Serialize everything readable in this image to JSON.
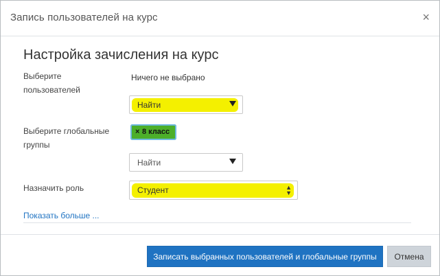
{
  "dialog": {
    "title": "Запись пользователей на курс",
    "close_glyph": "×",
    "section_title": "Настройка зачисления на курс"
  },
  "form": {
    "users": {
      "label": "Выберите пользователей",
      "value": "Ничего не выбрано",
      "search": "Найти"
    },
    "groups": {
      "label": "Выберите глобальные группы",
      "chip_remove": "×",
      "chip_label": "8 класс",
      "search": "Найти"
    },
    "role": {
      "label": "Назначить роль",
      "value": "Студент"
    },
    "show_more": "Показать больше ..."
  },
  "footer": {
    "submit_label": "Записать выбранных пользователей и глобальные группы",
    "cancel_label": "Отмена"
  },
  "colors": {
    "primary": "#1f73c2",
    "highlight": "#f4f000",
    "chip": "#4caf2a"
  }
}
